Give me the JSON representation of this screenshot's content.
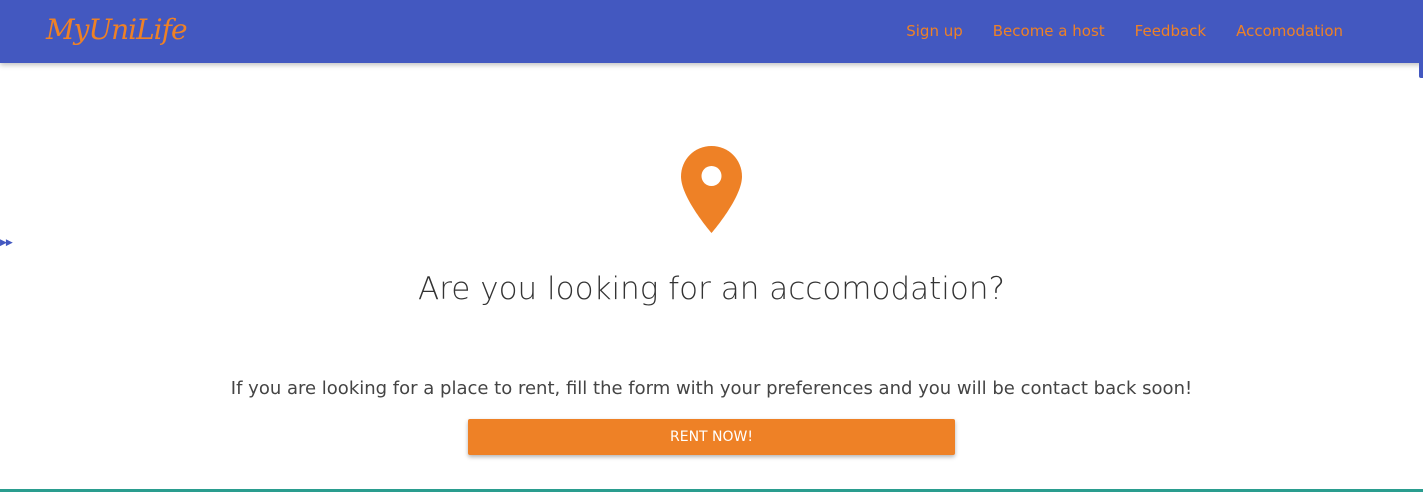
{
  "colors": {
    "navbar_bg": "#4358c0",
    "accent": "#ee8126",
    "button_text": "#ffffff",
    "heading_text": "#333333",
    "bottom_rule": "#2a9d8f"
  },
  "navbar": {
    "brand": "MyUniLife",
    "links": [
      {
        "label": "Sign up"
      },
      {
        "label": "Become a host"
      },
      {
        "label": "Feedback"
      },
      {
        "label": "Accomodation"
      }
    ]
  },
  "sidebar": {
    "toggle_icon": "double-play-icon",
    "toggle_glyph": "▶▶"
  },
  "main": {
    "icon": "map-pin-icon",
    "heading": "Are you looking for an accomodation?",
    "description": "If you are looking for a place to rent, fill the form with your preferences and you will be contact back soon!",
    "cta_label": "RENT NOW!"
  }
}
